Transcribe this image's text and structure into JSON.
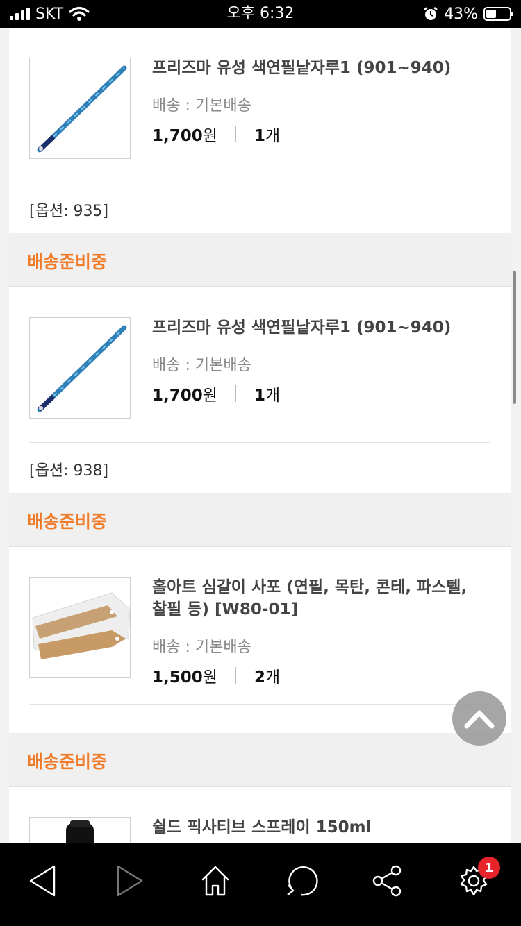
{
  "status_bar": {
    "carrier": "SKT",
    "time": "오후 6:32",
    "battery": "43%",
    "battery_level": 0.43
  },
  "orders": [
    {
      "product_name": "프리즈마 유성 색연필낱자루1 (901~940)",
      "shipping": "배송 : 기본배송",
      "price_value": "1,700",
      "price_unit": "원",
      "qty_value": "1",
      "qty_unit": "개",
      "option": "[옵션: 935]",
      "thumb": "pencil-image"
    },
    {
      "status": "배송준비중",
      "product_name": "프리즈마 유성 색연필낱자루1 (901~940)",
      "shipping": "배송 : 기본배송",
      "price_value": "1,700",
      "price_unit": "원",
      "qty_value": "1",
      "qty_unit": "개",
      "option": "[옵션: 938]",
      "thumb": "pencil-image"
    },
    {
      "status": "배송준비중",
      "product_name_line1": "홀아트 심갈이 사포 (연필, 목탄, 콘테, 파스텔,",
      "product_name_line2": "찰필 등) [W80-01]",
      "shipping": "배송 : 기본배송",
      "price_value": "1,500",
      "price_unit": "원",
      "qty_value": "2",
      "qty_unit": "개",
      "thumb": "sandpaper-image"
    },
    {
      "status": "배송준비중",
      "product_name": "쉴드 픽사티브 스프레이 150ml",
      "thumb": "spray-bottle-image"
    }
  ],
  "bottom_nav": {
    "items": [
      "back-icon",
      "forward-icon",
      "home-icon",
      "refresh-icon",
      "share-icon",
      "settings-icon"
    ],
    "settings_badge": "1"
  },
  "colors": {
    "status_orange": "#f07c2a",
    "badge_red": "#e6242a"
  }
}
